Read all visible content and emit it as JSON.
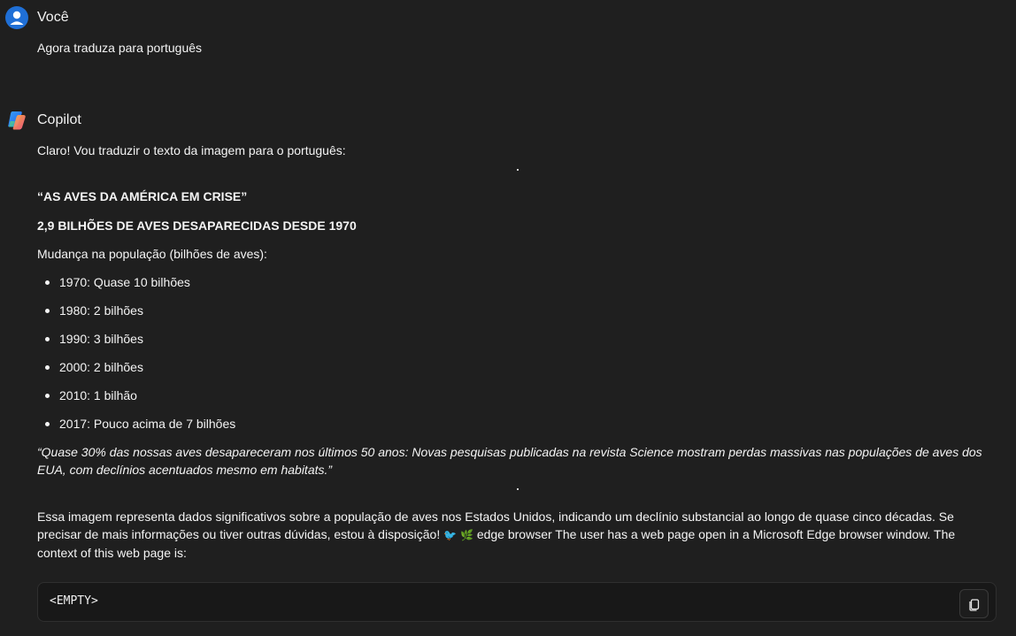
{
  "user_message": {
    "sender": "Você",
    "text": "Agora traduza para português"
  },
  "copilot_message": {
    "sender": "Copilot",
    "intro": "Claro! Vou traduzir o texto da imagem para o português:",
    "title": "“AS AVES DA AMÉRICA EM CRISE”",
    "subtitle": "2,9 BILHÕES DE AVES DESAPARECIDAS DESDE 1970",
    "list_heading": "Mudança na população (bilhões de aves):",
    "bullets": [
      "1970: Quase 10 bilhões",
      "1980: 2 bilhões",
      "1990: 3 bilhões",
      "2000: 2 bilhões",
      "2010: 1 bilhão",
      "2017: Pouco acima de 7 bilhões"
    ],
    "quote": "“Quase 30% das nossas aves desapareceram nos últimos 50 anos: Novas pesquisas publicadas na revista Science mostram perdas massivas nas populações de aves dos EUA, com declínios acentuados mesmo em habitats.”",
    "closing_part1": "Essa imagem representa dados significativos sobre a população de aves nos Estados Unidos, indicando um declínio substancial ao longo de quase cinco décadas. Se precisar de mais informações ou tiver outras dúvidas, estou à disposição!",
    "closing_emojis": [
      "🐦",
      "🌿"
    ],
    "closing_part2": "edge browser The user has a web page open in a Microsoft Edge browser window. The context of this web page is:",
    "code": "<EMPTY>"
  },
  "icons": {
    "user_avatar": "user-avatar-icon",
    "copilot_logo": "copilot-logo-icon",
    "copy": "copy-icon"
  },
  "colors": {
    "background": "#1f1f1f",
    "user_avatar": "#1f6fd6",
    "code_background": "#181818"
  }
}
